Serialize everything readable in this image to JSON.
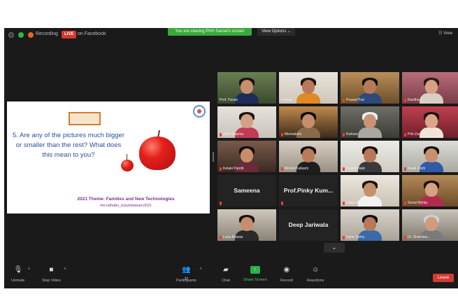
{
  "topbar": {
    "recording_label": "Recording",
    "live_badge": "LIVE",
    "live_target": "on Facebook",
    "share_banner": "You are viewing PHH Sarsel's screen",
    "view_options": "View Options",
    "view_mode": "View"
  },
  "slide": {
    "question": "5. Are any of the pictures much bigger or smaller than the rest? What does this mean to you?",
    "footer_title": "2021 Theme: Families and New Technologies",
    "footer_tag": "#ecodhabo_kutumbakam2021"
  },
  "participants": [
    {
      "name": "Prof. Pavan",
      "mic_off": false,
      "active": true
    },
    {
      "name": "Prayag",
      "mic_off": false
    },
    {
      "name": "Prasad Puri",
      "mic_off": true
    },
    {
      "name": "Kavitha K",
      "mic_off": true
    },
    {
      "name": "Aarti Sharma",
      "mic_off": true
    },
    {
      "name": "Meenakshi",
      "mic_off": true
    },
    {
      "name": "Kishore",
      "mic_off": true
    },
    {
      "name": "Priti Zaveri",
      "mic_off": true
    },
    {
      "name": "Ketaki Pandit",
      "mic_off": true
    },
    {
      "name": "Mohini Kulkarni",
      "mic_off": true
    },
    {
      "name": "Srushti Naik",
      "mic_off": true
    },
    {
      "name": "Swati Joshi",
      "mic_off": true
    },
    {
      "name": "Sameena",
      "big_name": true,
      "mic_off": true
    },
    {
      "name": "Prof.Pinky Kum...",
      "big_name": true,
      "mic_off": true
    },
    {
      "name": "Charu Bharadwaj",
      "mic_off": true
    },
    {
      "name": "Sonal Mehta",
      "mic_off": true
    },
    {
      "name": "Luna Biswas",
      "mic_off": true
    },
    {
      "name": "Deep Jariwala",
      "big_name": true,
      "mic_off": false
    },
    {
      "name": "Saba Sinha",
      "mic_off": true
    },
    {
      "name": "Dr. Shamina...",
      "mic_off": true
    }
  ],
  "more_button": "⌄",
  "toolbar": {
    "unmute": "Unmute",
    "stop_video": "Stop Video",
    "participants": "Participants",
    "participants_count": "37",
    "chat": "Chat",
    "share_screen": "Share Screen",
    "record": "Record",
    "reactions": "Reactions",
    "leave": "Leave"
  },
  "colors": {
    "accent_active": "#c9dc3a",
    "share_green": "#3aa93a",
    "leave_red": "#d33a30",
    "slide_text": "#2b4f9b",
    "slide_footer": "#7b2f8c"
  }
}
